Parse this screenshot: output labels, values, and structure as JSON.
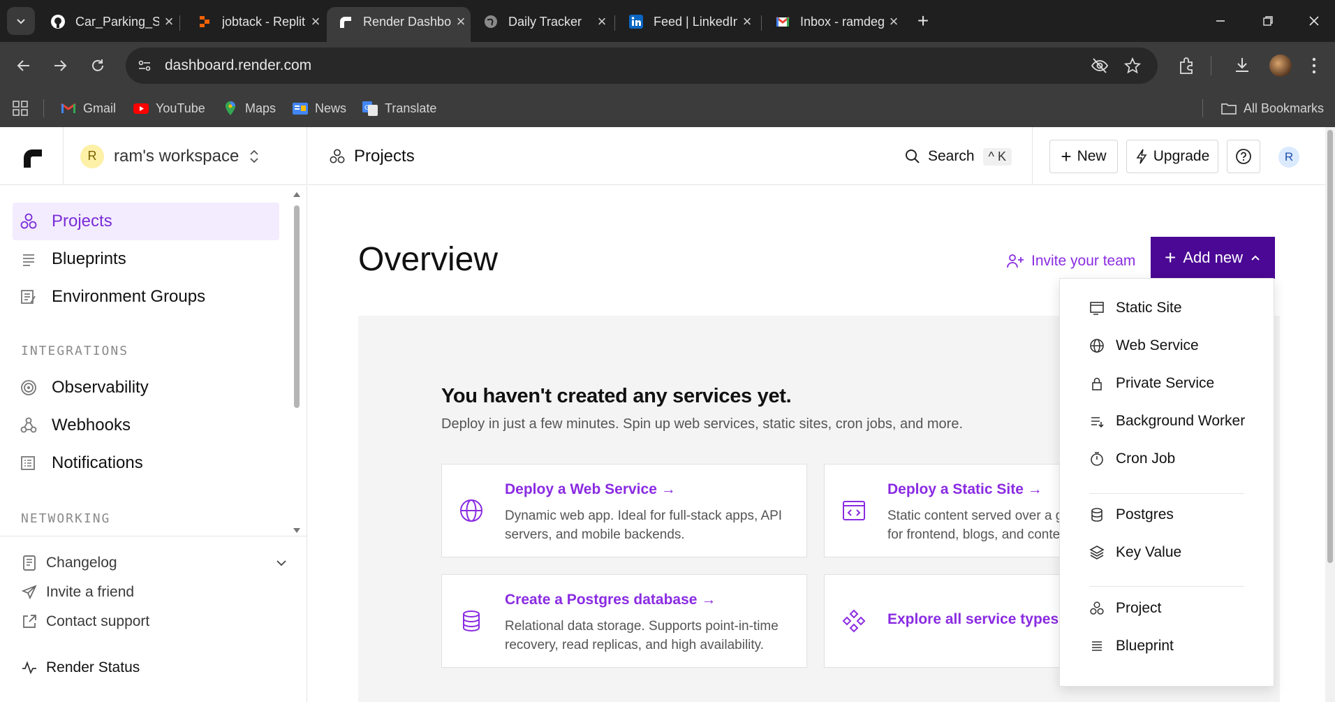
{
  "browser": {
    "tabs": [
      {
        "title": "Car_Parking_Slot/v",
        "icon": "github-icon"
      },
      {
        "title": "jobtack - Replit",
        "icon": "replit-icon"
      },
      {
        "title": "Render Dashboard",
        "icon": "render-icon",
        "active": true
      },
      {
        "title": "Daily Tracker",
        "icon": "globe-icon"
      },
      {
        "title": "Feed | LinkedIn",
        "icon": "linkedin-icon"
      },
      {
        "title": "Inbox - ramdegala",
        "icon": "gmail-icon"
      }
    ],
    "url": "dashboard.render.com",
    "bookmarks": [
      {
        "label": "Gmail",
        "icon": "gmail-icon"
      },
      {
        "label": "YouTube",
        "icon": "youtube-icon"
      },
      {
        "label": "Maps",
        "icon": "maps-icon"
      },
      {
        "label": "News",
        "icon": "news-icon"
      },
      {
        "label": "Translate",
        "icon": "translate-icon"
      }
    ],
    "all_bookmarks": "All Bookmarks"
  },
  "sidebar": {
    "workspace_initial": "R",
    "workspace_name": "ram's workspace",
    "items": [
      {
        "label": "Projects",
        "icon": "projects-icon",
        "active": true
      },
      {
        "label": "Blueprints",
        "icon": "blueprints-icon"
      },
      {
        "label": "Environment Groups",
        "icon": "environment-groups-icon"
      }
    ],
    "integrations_label": "INTEGRATIONS",
    "integrations": [
      {
        "label": "Observability",
        "icon": "observability-icon"
      },
      {
        "label": "Webhooks",
        "icon": "webhooks-icon"
      },
      {
        "label": "Notifications",
        "icon": "notifications-icon"
      }
    ],
    "networking_label": "NETWORKING",
    "footer": [
      {
        "label": "Changelog",
        "icon": "changelog-icon"
      },
      {
        "label": "Invite a friend",
        "icon": "send-icon"
      },
      {
        "label": "Contact support",
        "icon": "external-link-icon"
      },
      {
        "label": "Render Status",
        "icon": "activity-icon"
      }
    ]
  },
  "topbar": {
    "breadcrumb": "Projects",
    "search_label": "Search",
    "search_shortcut": "^ K",
    "new_label": "New",
    "upgrade_label": "Upgrade",
    "avatar_initial": "R"
  },
  "main": {
    "title": "Overview",
    "invite_label": "Invite your team",
    "add_new_label": "Add new",
    "empty_title": "You haven't created any services yet.",
    "empty_subtitle": "Deploy in just a few minutes. Spin up web services, static sites, cron jobs, and more.",
    "cards": [
      {
        "title": "Deploy a Web Service",
        "desc": "Dynamic web app. Ideal for full-stack apps, API servers, and mobile backends."
      },
      {
        "title": "Deploy a Static Site",
        "desc": "Static content served over a global CDN. Ideal for frontend, blogs, and content sites."
      },
      {
        "title": "Create a Postgres database",
        "desc": "Relational data storage. Supports point-in-time recovery, read replicas, and high availability."
      },
      {
        "title": "Explore all service types",
        "desc": ""
      }
    ]
  },
  "add_new_menu": {
    "group1": [
      "Static Site",
      "Web Service",
      "Private Service",
      "Background Worker",
      "Cron Job"
    ],
    "group2": [
      "Postgres",
      "Key Value"
    ],
    "group3": [
      "Project",
      "Blueprint"
    ]
  },
  "colors": {
    "accent": "#8a2be2",
    "add_new_bg": "#4a0894",
    "active_nav_bg": "#f3ecff"
  }
}
